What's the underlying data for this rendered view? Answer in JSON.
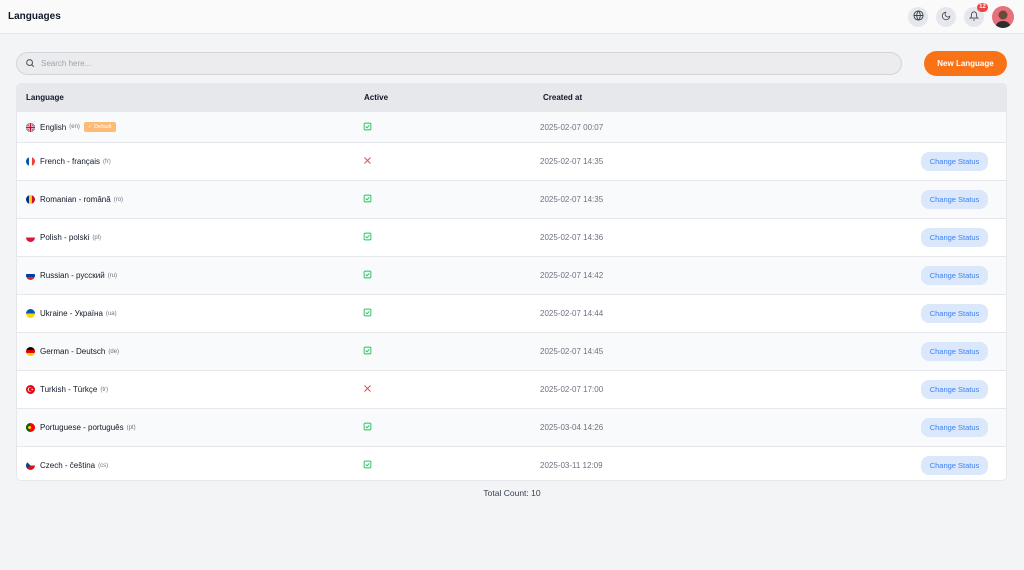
{
  "header": {
    "title": "Languages",
    "notification_count": "12"
  },
  "search": {
    "placeholder": "Search here..."
  },
  "new_button": "New Language",
  "table": {
    "columns": [
      "Language",
      "Active",
      "Created at"
    ],
    "change_status_label": "Change Status",
    "default_label": "Default",
    "rows": [
      {
        "name": "English",
        "code": "(en)",
        "active": true,
        "created": "2025-02-07 00:07",
        "is_default": true,
        "flag": "gb"
      },
      {
        "name": "French - français",
        "code": "(fr)",
        "active": false,
        "created": "2025-02-07 14:35",
        "flag": "fr"
      },
      {
        "name": "Romanian - română",
        "code": "(ro)",
        "active": true,
        "created": "2025-02-07 14:35",
        "flag": "ro"
      },
      {
        "name": "Polish - polski",
        "code": "(pl)",
        "active": true,
        "created": "2025-02-07 14:36",
        "flag": "pl"
      },
      {
        "name": "Russian - русский",
        "code": "(ru)",
        "active": true,
        "created": "2025-02-07 14:42",
        "flag": "ru"
      },
      {
        "name": "Ukraine - Україна",
        "code": "(ua)",
        "active": true,
        "created": "2025-02-07 14:44",
        "flag": "ua"
      },
      {
        "name": "German - Deutsch",
        "code": "(de)",
        "active": true,
        "created": "2025-02-07 14:45",
        "flag": "de"
      },
      {
        "name": "Turkish - Türkçe",
        "code": "(tr)",
        "active": false,
        "created": "2025-02-07 17:00",
        "flag": "tr"
      },
      {
        "name": "Portuguese - português",
        "code": "(pt)",
        "active": true,
        "created": "2025-03-04 14:26",
        "flag": "pt"
      },
      {
        "name": "Czech - čeština",
        "code": "(cs)",
        "active": true,
        "created": "2025-03-11 12:09",
        "flag": "cz"
      }
    ]
  },
  "footer": {
    "total": "Total Count: 10"
  },
  "colors": {
    "accent": "#f97316",
    "active": "#22c55e",
    "inactive": "#ef4444",
    "link": "#3b82f6"
  }
}
